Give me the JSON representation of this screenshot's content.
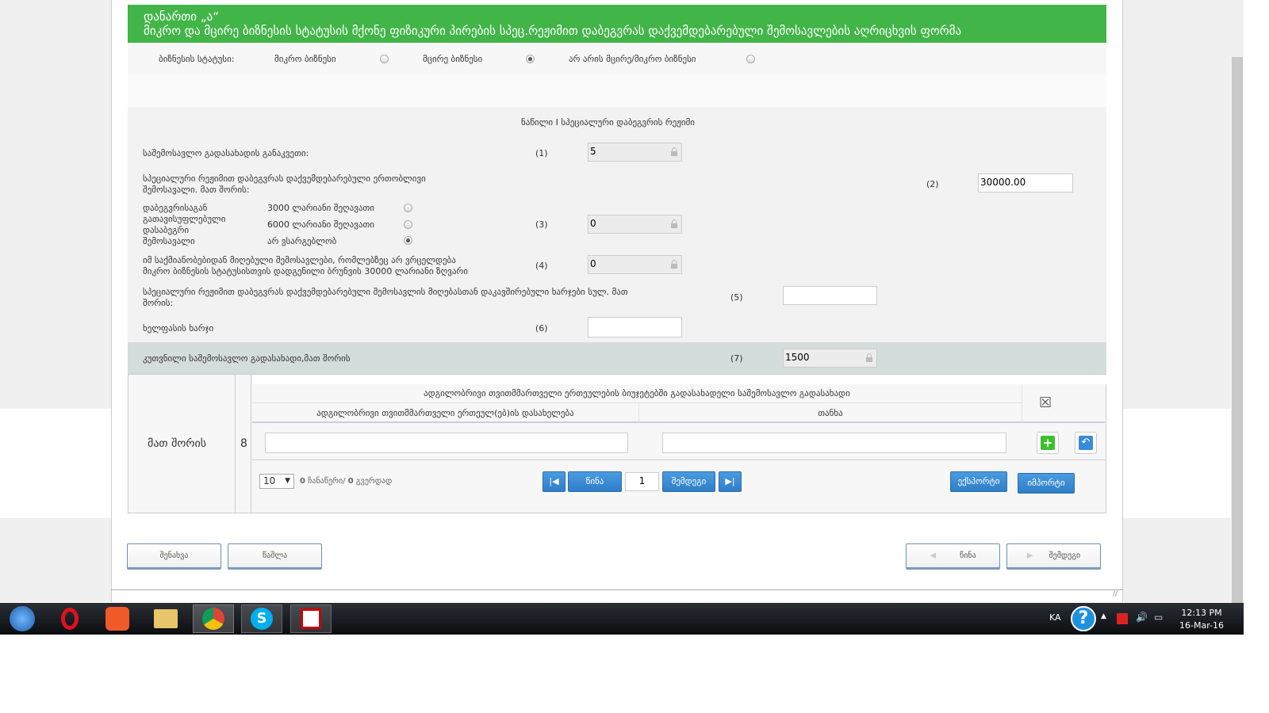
{
  "header": {
    "line1": "დანართი „ა“",
    "line2": "მიკრო და მცირე ბიზნესის სტატუსის მქონე ფიზიკური პირების სპეც.რეჟიმით დაბეგვრას დაქვემდებარებული შემოსავლების აღრიცხვის ფორმა"
  },
  "status": {
    "label": "ბიზნესის სტატუსი:",
    "options": [
      {
        "label": "მიკრო ბიზნესი",
        "checked": false
      },
      {
        "label": "მცირე ბიზნესი",
        "checked": true
      },
      {
        "label": "არ არის მცირე/მიკრო ბიზნესი",
        "checked": false
      }
    ]
  },
  "section_title": "ნაწილი I სპეციალური დაბეგვრის რეჟიმი",
  "rows": {
    "r1": {
      "label": "საშემოსავლო გადასახადის განაკვეთი:",
      "num": "(1)",
      "value": "5"
    },
    "r2": {
      "label1": "სპეციალური რეჟიმით დაბეგვრას დაქვემდებარებული ერთობლივი",
      "label2": "შემოსავალი. მათ შორის:",
      "num": "(2)",
      "value": "30000.00"
    },
    "r3": {
      "label": [
        "დაბეგვრისაგან",
        "გათავისუფლებული",
        "დასაბეგრი",
        "შემოსავალი"
      ],
      "options": [
        {
          "label": "3000 ლარიანი შეღავათი",
          "checked": false
        },
        {
          "label": "6000 ლარიანი შეღავათი",
          "checked": false
        },
        {
          "label": "არ ვსარგებლობ",
          "checked": true
        }
      ],
      "num": "(3)",
      "value": "0"
    },
    "r4": {
      "label1": "იმ საქმიანობებიდან მიღებული შემოსავლები, რომლებზეც არ ვრცელდება",
      "label2": "მიკრო ბიზნესის სტატუსისთვის დადგენილი ბრუნვის 30000 ლარიანი ზღვარი",
      "num": "(4)",
      "value": "0"
    },
    "r5": {
      "label1": "სპეციალური რეჟიმით დაბეგვრას დაქვემდებარებული შემოსავლის მიღებასთან დაკავშირებული ხარჯები სულ. მათ",
      "label2": "შორის:",
      "num": "(5)",
      "value": ""
    },
    "r6": {
      "label": "ხელფასის ხარჯი",
      "num": "(6)",
      "value": ""
    },
    "r7": {
      "label": "კუთვნილი საშემოსავლო გადასახადი,მათ შორის",
      "num": "(7)",
      "value": "1500"
    }
  },
  "table": {
    "side_label": "მათ შორის",
    "side_num": "8",
    "group_header": "ადგილობრივი თვითმმართველი ერთეულების ბიუჯეტებში გადასახადელი საშემოსავლო გადასახადი",
    "col1": "ადგილობრივი თვითმმართველი ერთეულ(ებ)ის დასახელება",
    "col2": "თანხა",
    "page_size": "10",
    "records_count": "0",
    "records_text": "ჩანაწერი/",
    "pages_count": "0",
    "pages_text": "გვერდად",
    "prev": "წინა",
    "page": "1",
    "next": "შემდეგი",
    "export": "ექსპორტი",
    "import": "იმპორტი"
  },
  "footer": {
    "save": "შენახვა",
    "delete": "წაშლა",
    "back": "წინა",
    "forward": "შემდეგი"
  },
  "taskbar": {
    "lang": "KA",
    "time": "12:13 PM",
    "date": "16-Mar-16"
  },
  "colors": {
    "header": "#42b549",
    "button": "#3a8bd6"
  }
}
